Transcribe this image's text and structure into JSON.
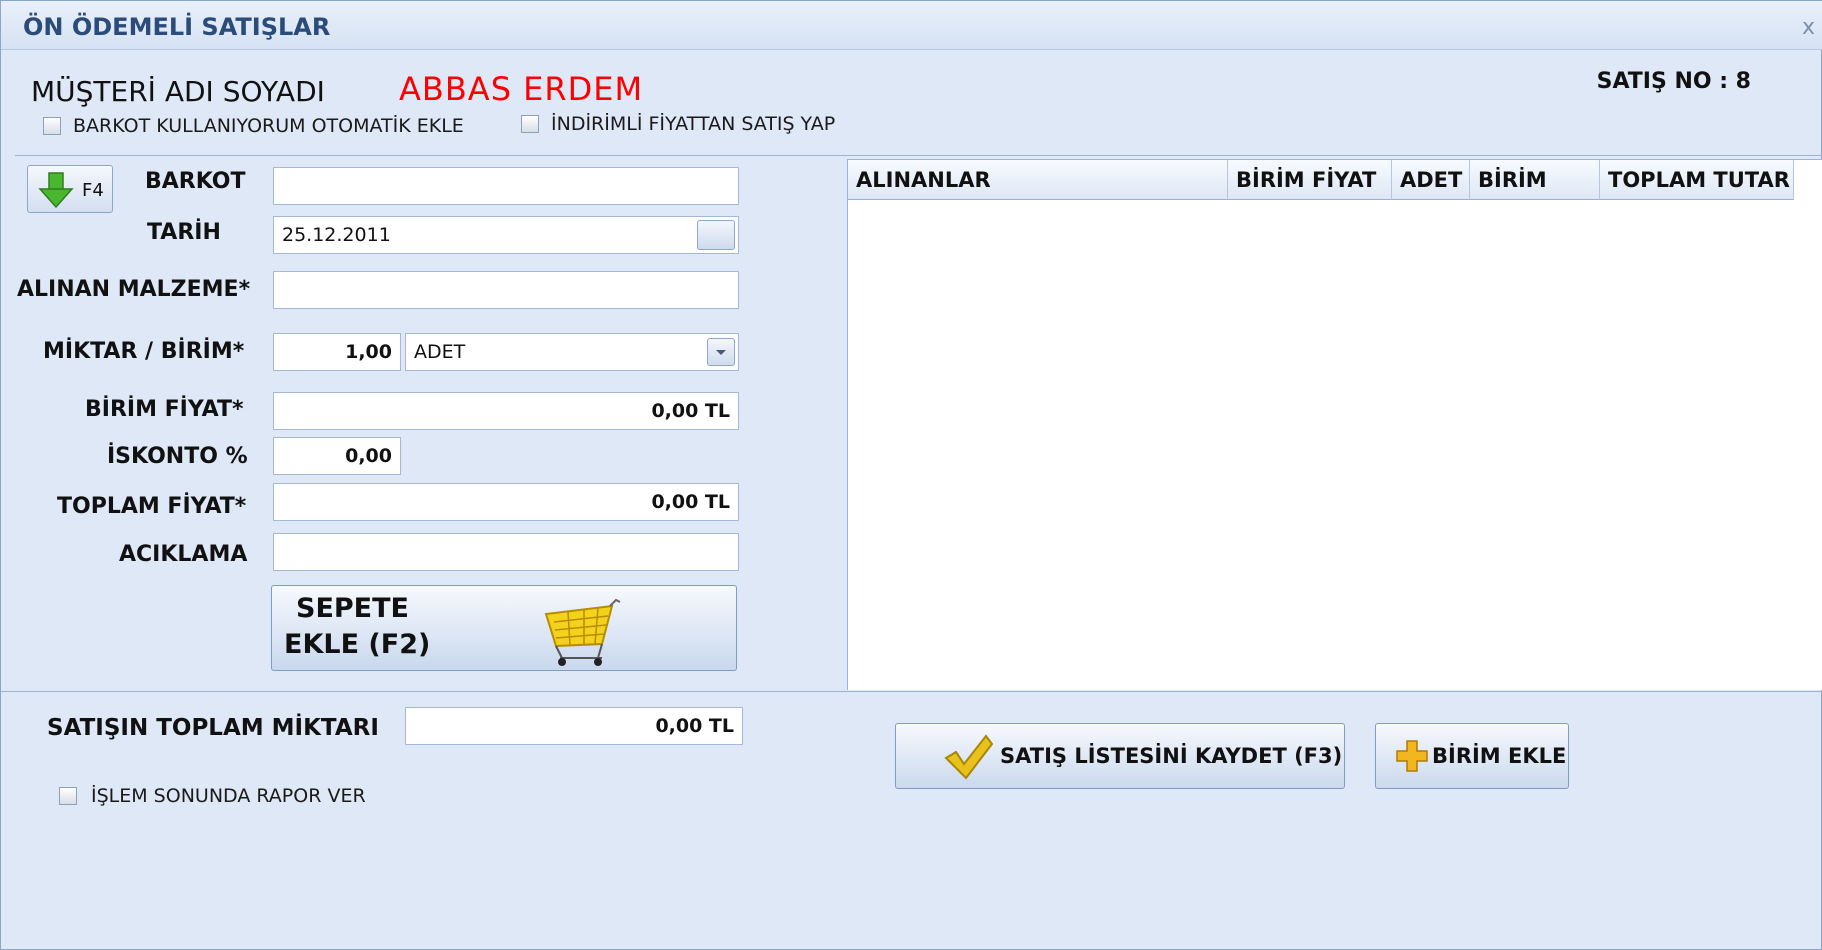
{
  "window": {
    "title": "ÖN ÖDEMELİ SATIŞLAR",
    "close_glyph": "x"
  },
  "header": {
    "customer_label": "MÜŞTERİ ADI SOYADI",
    "customer_name": "ABBAS ERDEM",
    "sale_no_label": "SATIŞ NO :  8",
    "barcode_auto_add_label": "BARKOT KULLANIYORUM OTOMATİK EKLE",
    "discount_price_sale_label": "İNDİRİMLİ FİYATTAN SATIŞ YAP"
  },
  "form": {
    "f4_button_label": "F4",
    "barcode_label": "BARKOT",
    "barcode_value": "",
    "date_label": "TARİH",
    "date_value": "25.12.2011",
    "item_label": "ALINAN MALZEME*",
    "item_value": "",
    "qty_unit_label": "MİKTAR / BİRİM*",
    "qty_value": "1,00",
    "unit_value": "ADET",
    "unit_price_label": "BİRİM FİYAT*",
    "unit_price_value": "0,00 TL",
    "discount_label": "İSKONTO %",
    "discount_value": "0,00",
    "total_price_label": "TOPLAM FİYAT*",
    "total_price_value": "0,00 TL",
    "description_label": "ACIKLAMA",
    "description_value": "",
    "add_to_cart_line1": "SEPETE",
    "add_to_cart_line2": "EKLE (F2)"
  },
  "grid": {
    "columns": [
      "ALINANLAR",
      "BİRİM FİYAT",
      "ADET",
      "BİRİM",
      "TOPLAM TUTAR"
    ],
    "rows": []
  },
  "footer": {
    "sale_total_label": "SATIŞIN TOPLAM MİKTARI",
    "sale_total_value": "0,00 TL",
    "report_label": "İŞLEM SONUNDA RAPOR VER",
    "save_button_label": "SATIŞ LİSTESİNİ KAYDET (F3)",
    "add_unit_button_label": "BİRİM EKLE"
  },
  "colors": {
    "customer_name": "#ff0000",
    "window_bg": "#dfe8f6",
    "arrow_green": "#3fae2a",
    "gold": "#e3b500"
  },
  "icons": [
    "down-arrow-icon",
    "calendar-icon",
    "dropdown-arrow-icon",
    "shopping-cart-icon",
    "check-mark-icon",
    "plus-icon",
    "close-icon"
  ]
}
